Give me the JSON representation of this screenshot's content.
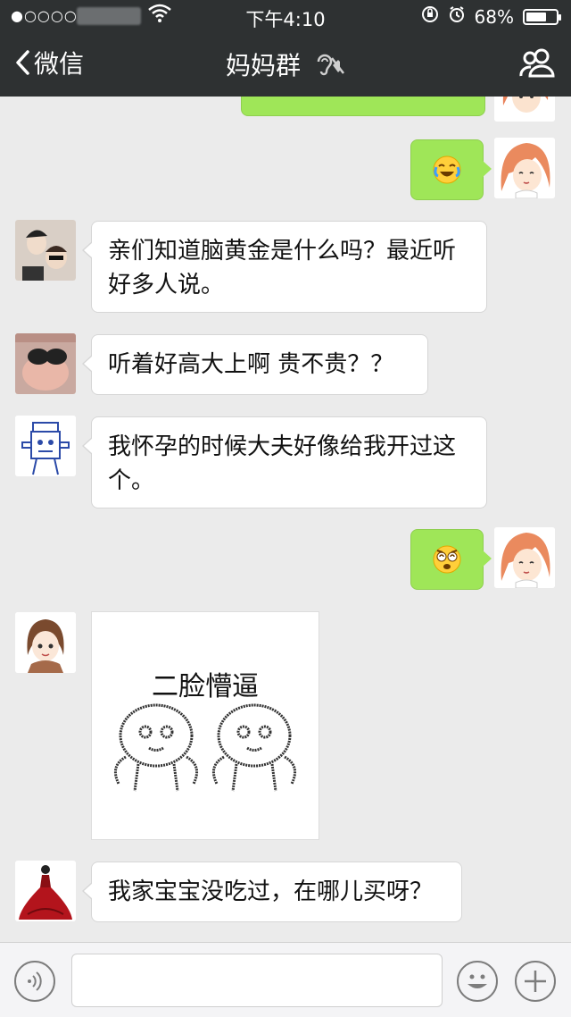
{
  "status_bar": {
    "signal": "●○○○○",
    "time": "下午4:10",
    "battery": "68%",
    "battery_level": 0.68
  },
  "nav": {
    "back_label": "微信",
    "title": "妈妈群"
  },
  "messages": [
    {
      "side": "right",
      "type": "emoji",
      "icon": "crying-laughing-emoji"
    },
    {
      "side": "left",
      "type": "text",
      "text": "亲们知道脑黄金是什么吗？最近听好多人说。"
    },
    {
      "side": "left",
      "type": "text",
      "text": "听着好高大上啊  贵不贵？？"
    },
    {
      "side": "left",
      "type": "text",
      "text": "我怀孕的时候大夫好像给我开过这个。"
    },
    {
      "side": "right",
      "type": "emoji",
      "icon": "dizzy-confused-emoji"
    },
    {
      "side": "left",
      "type": "sticker",
      "caption": "二脸懵逼"
    },
    {
      "side": "left",
      "type": "text",
      "text": "我家宝宝没吃过，在哪儿买呀？"
    }
  ],
  "colors": {
    "nav_bg": "#2e3132",
    "chat_bg": "#ebebeb",
    "my_bubble": "#9fe658"
  }
}
